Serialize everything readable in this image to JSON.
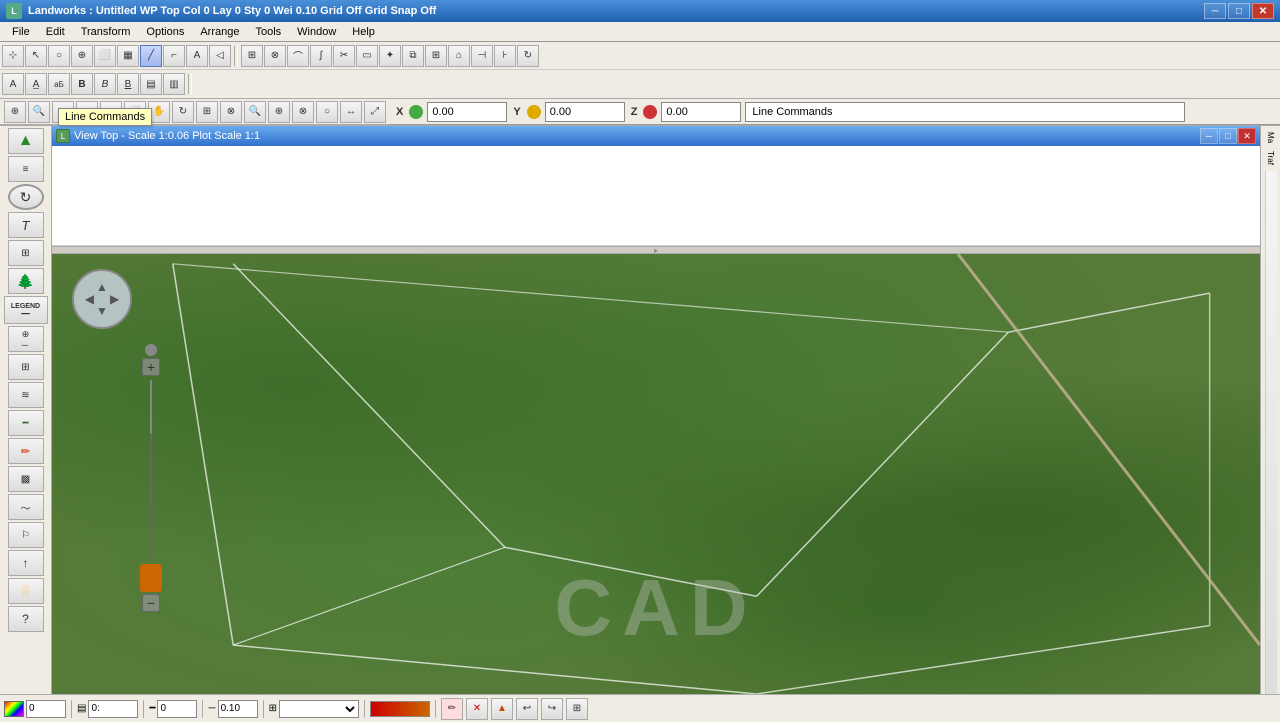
{
  "titleBar": {
    "icon": "L",
    "title": "Landworks : Untitled   WP Top   Col 0 Lay 0   Sty 0 Wei 0.10   Grid Off   Grid Snap Off",
    "buttons": {
      "minimize": "─",
      "maximize": "□",
      "close": "✕"
    }
  },
  "menuBar": {
    "items": [
      "File",
      "Edit",
      "Transform",
      "Options",
      "Arrange",
      "Tools",
      "Window",
      "Help"
    ]
  },
  "coordBar": {
    "x_label": "X",
    "y_label": "Y",
    "z_label": "Z",
    "x_value": "0.00",
    "y_value": "0.00",
    "z_value": "0.00",
    "status": "Line Commands"
  },
  "tooltip": {
    "text": "Line Commands"
  },
  "innerWindow": {
    "title": "View Top - Scale 1:0.06  Plot Scale 1:1",
    "buttons": {
      "minimize": "─",
      "maximize": "□",
      "close": "✕"
    }
  },
  "navWidget": {
    "arrow": "⊕"
  },
  "zoomWidget": {
    "plus": "+",
    "minus": "−"
  },
  "rightPanel": {
    "items": [
      "Ma",
      "Traf"
    ]
  },
  "bottomBar": {
    "color_value": "0",
    "layer_icon": "layer",
    "layer_value": "0:",
    "line_weight": "0",
    "line_scale": "0.10",
    "style_label": ""
  }
}
